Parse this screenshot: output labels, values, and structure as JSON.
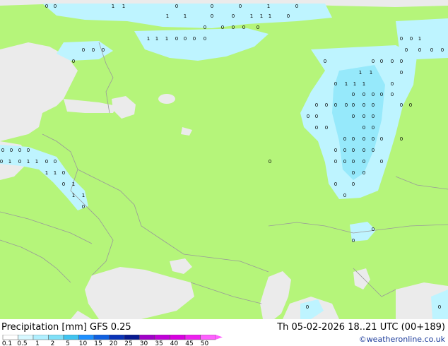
{
  "map": {
    "type": "precipitation",
    "colors": {
      "land": "#b5f57a",
      "sea": "#ebebeb",
      "precip_light": "#bef4ff",
      "precip_medium": "#96e9fb",
      "border": "#999999"
    },
    "marker_values": [
      "0",
      "1"
    ]
  },
  "footer": {
    "title": "Precipitation [mm]  GFS 0.25",
    "valid": "Th 05-02-2026 18..21 UTC (00+189)",
    "credit": "©weatheronline.co.uk"
  },
  "legend": {
    "labels": [
      "0.1",
      "0.5",
      "1",
      "2",
      "5",
      "10",
      "15",
      "20",
      "25",
      "30",
      "35",
      "40",
      "45",
      "50"
    ],
    "colors": [
      "#ffffff",
      "#d8f8ff",
      "#b0efff",
      "#7fe0f8",
      "#40c4f0",
      "#1e90ff",
      "#1060e0",
      "#0a34b8",
      "#081a90",
      "#a000c8",
      "#c000d8",
      "#d800e0",
      "#ee20f0",
      "#ff60ff"
    ]
  }
}
